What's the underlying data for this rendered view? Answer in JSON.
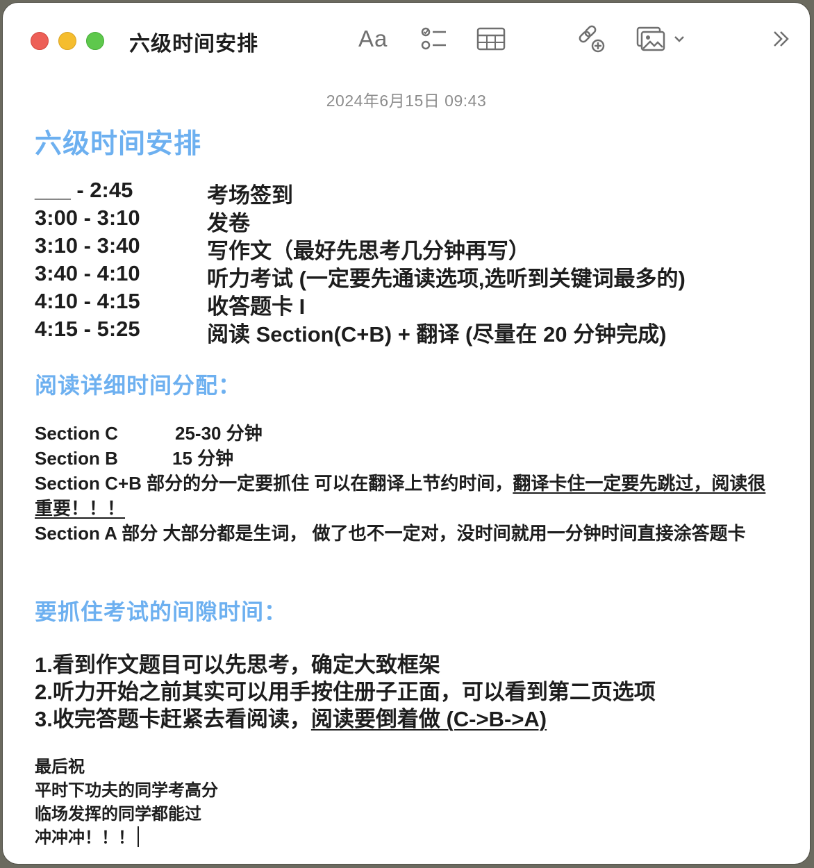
{
  "window": {
    "title": "六级时间安排",
    "toolbar": {
      "format_label": "Aa",
      "icons": [
        "text-format-icon",
        "checklist-icon",
        "table-icon",
        "collaborate-icon",
        "media-icon",
        "chevron-down-icon",
        "more-icon"
      ]
    }
  },
  "note": {
    "date": "2024年6月15日 09:43",
    "title": "六级时间安排",
    "schedule": [
      {
        "time": "___ -  2:45",
        "task": "考场签到"
      },
      {
        "time": "3:00 - 3:10",
        "task": "发卷"
      },
      {
        "time": "3:10  - 3:40",
        "task": "写作文（最好先思考几分钟再写）"
      },
      {
        "time": "3:40 - 4:10",
        "task": "听力考试 (一定要先通读选项,选听到关键词最多的)"
      },
      {
        "time": "4:10 - 4:15",
        "task": "收答题卡 I"
      },
      {
        "time": "4:15 - 5:25",
        "task": " 阅读 Section(C+B) + 翻译 (尽量在 20 分钟完成)"
      }
    ],
    "reading_heading": "阅读详细时间分配：",
    "reading": {
      "section_c_label": "Section C",
      "section_c_time": "25-30 分钟",
      "section_b_label": "Section B",
      "section_b_time": "15 分钟",
      "cb_note_plain": "Section C+B 部分的分一定要抓住 可以在翻译上节约时间，",
      "cb_note_underlined": "翻译卡住一定要先跳过，阅读很重要！！！",
      "a_note": "Section A 部分 大部分都是生词， 做了也不一定对，没时间就用一分钟时间直接涂答题卡"
    },
    "gap_heading": "要抓住考试的间隙时间：",
    "tips": {
      "tip1": "1.看到作文题目可以先思考，确定大致框架",
      "tip2": "2.听力开始之前其实可以用手按住册子正面，可以看到第二页选项",
      "tip3_plain": "3.收完答题卡赶紧去看阅读，",
      "tip3_underlined": "阅读要倒着做 (C->B->A)"
    },
    "closing": {
      "line1": "最后祝",
      "line2": "平时下功夫的同学考高分",
      "line3": "临场发挥的同学都能过",
      "line4": "冲冲冲！！！"
    }
  }
}
